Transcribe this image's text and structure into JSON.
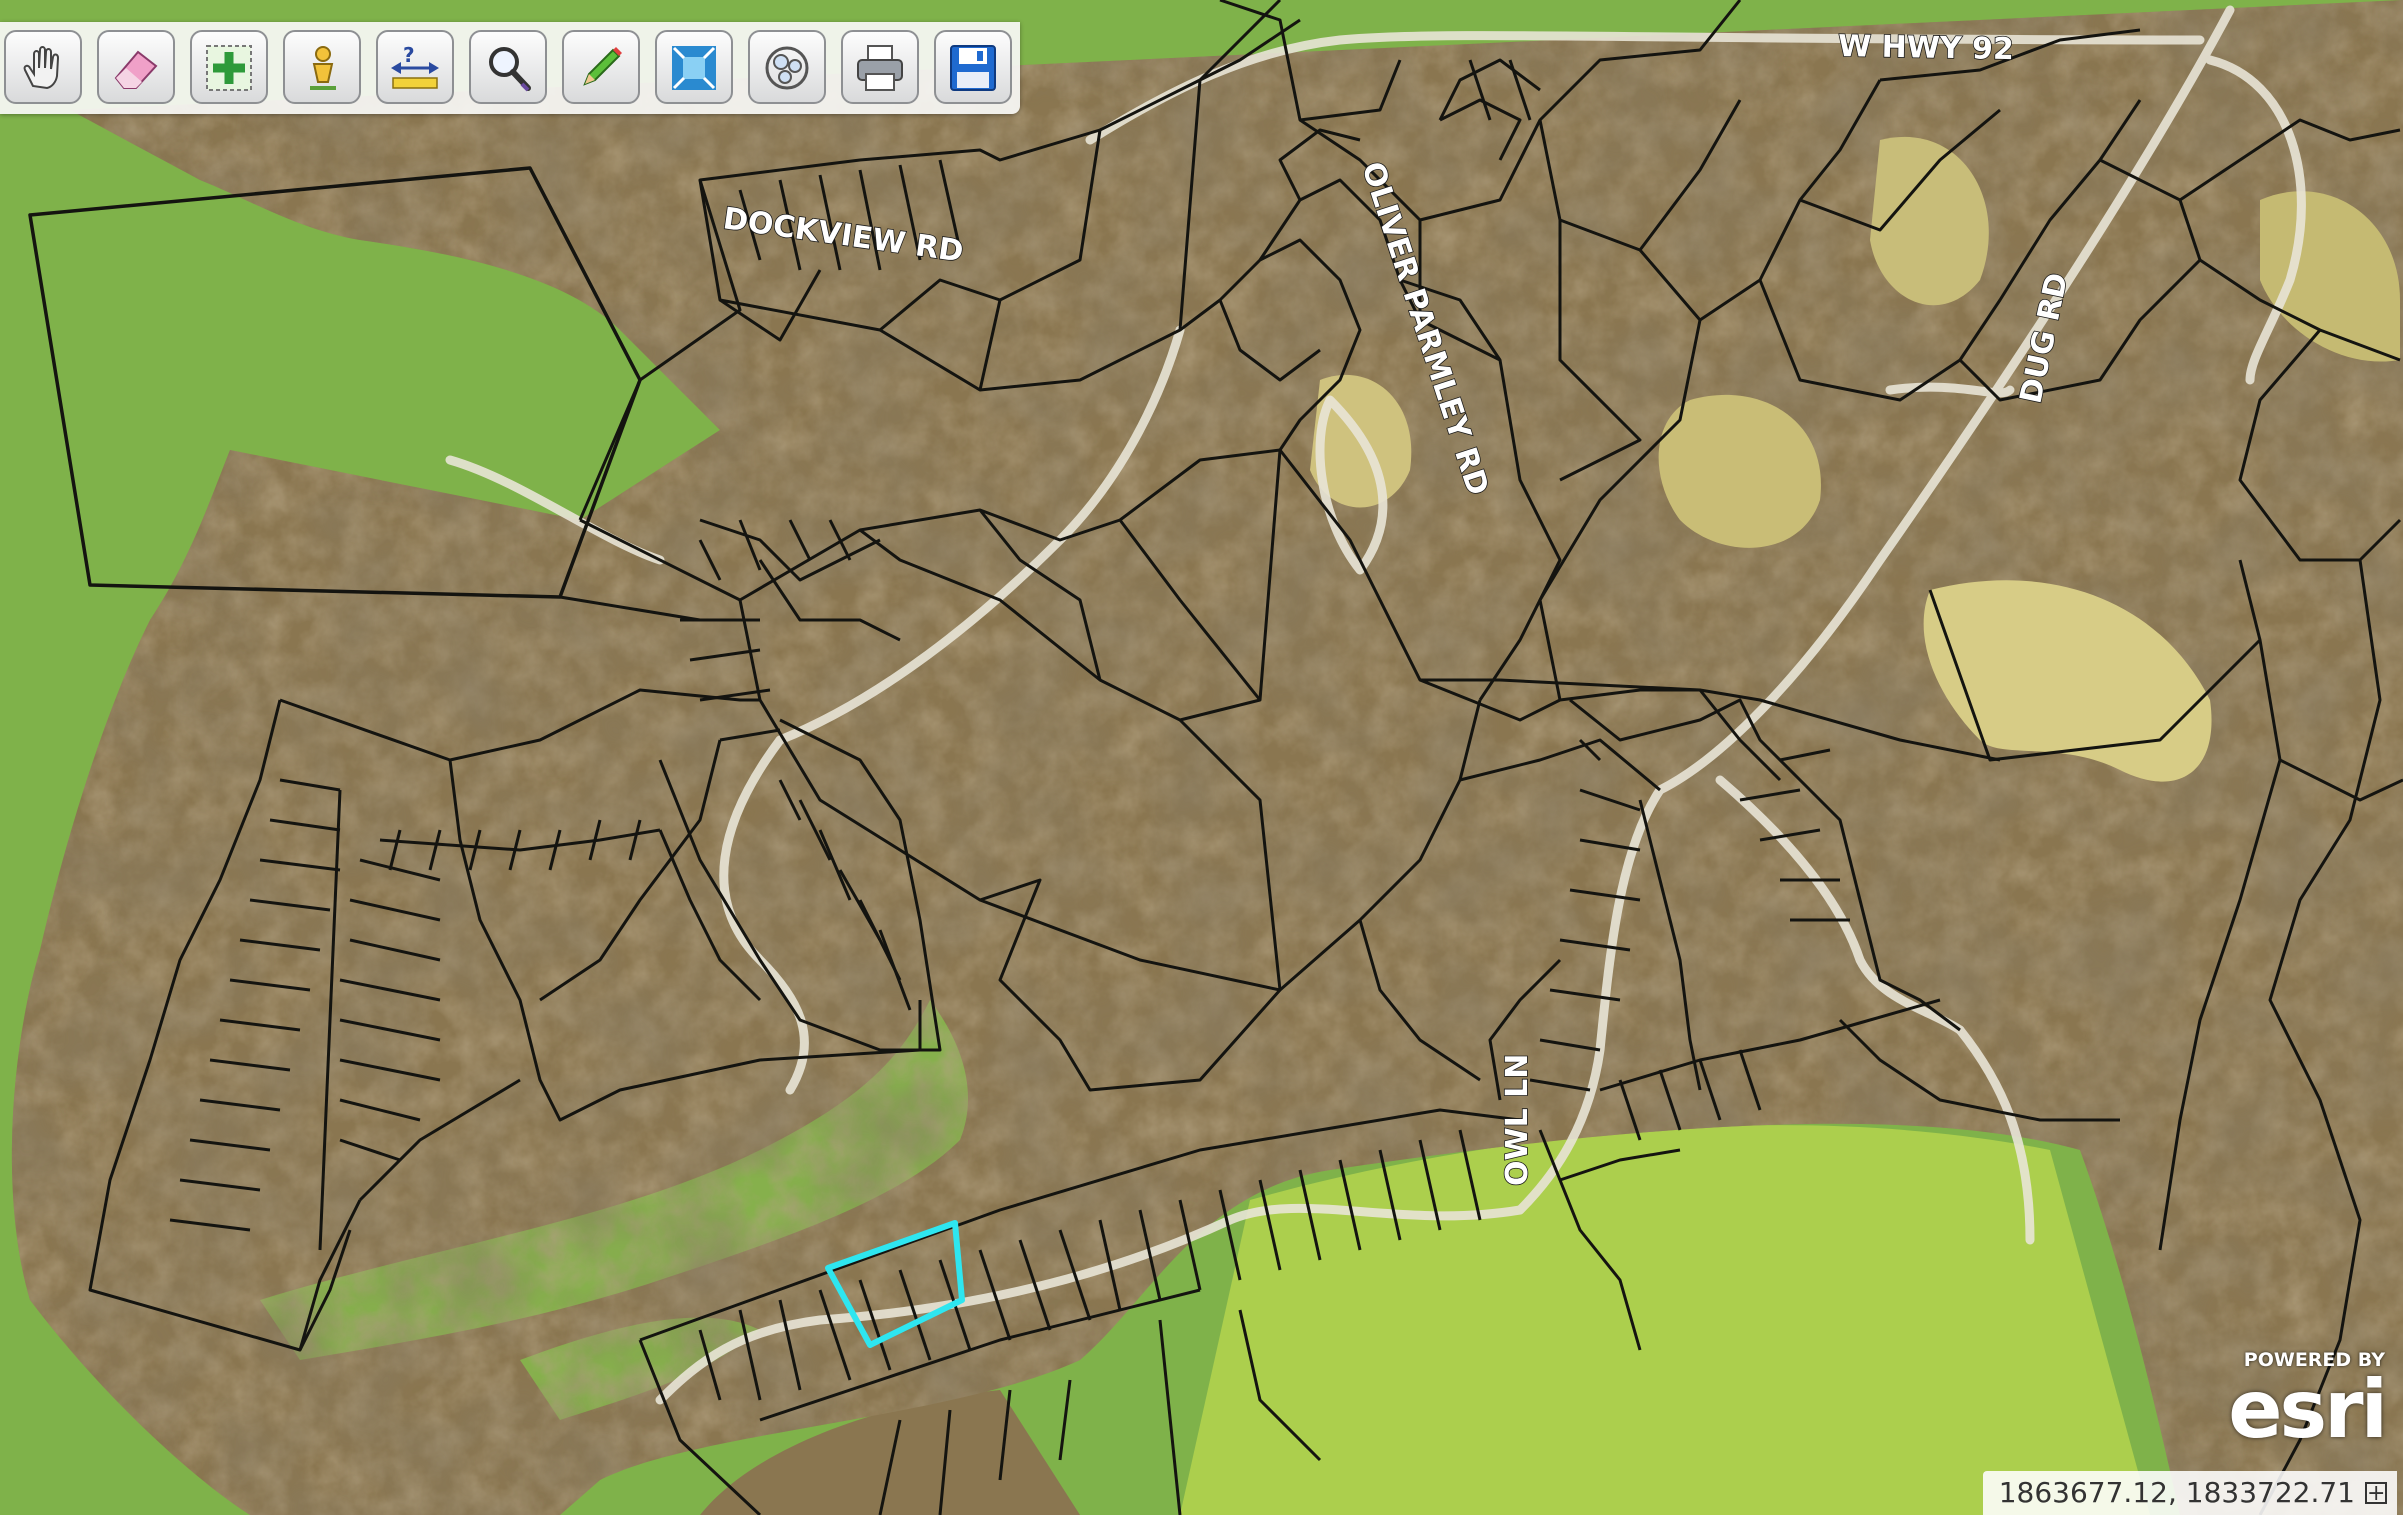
{
  "map": {
    "roads": {
      "w_hwy_92": "W HWY 92",
      "dockview_rd": "DOCKVIEW RD",
      "oliver_parmley_rd": "OLIVER PARMLEY RD",
      "dug_rd": "DUG RD",
      "owl_ln": "OWL LN"
    },
    "parcel_line_color": "#141410",
    "selected_parcel_color": "#2ee6f0",
    "water_color": "#7fb24a",
    "land_color": "#8e7a52"
  },
  "toolbar": {
    "tools": [
      {
        "name": "pan",
        "icon": "hand-icon"
      },
      {
        "name": "clear",
        "icon": "eraser-icon"
      },
      {
        "name": "zoom-full",
        "icon": "full-extent-icon"
      },
      {
        "name": "identify",
        "icon": "person-pin-icon"
      },
      {
        "name": "measure",
        "icon": "measure-icon"
      },
      {
        "name": "search",
        "icon": "magnifier-icon"
      },
      {
        "name": "draw",
        "icon": "pencil-icon"
      },
      {
        "name": "zoom-extent",
        "icon": "zoom-extent-icon"
      },
      {
        "name": "buffer",
        "icon": "buffer-icon"
      },
      {
        "name": "print",
        "icon": "printer-icon"
      },
      {
        "name": "save",
        "icon": "floppy-disk-icon"
      }
    ]
  },
  "status": {
    "coordinates": "1863677.12, 1833722.71",
    "coord_toggle": "+"
  },
  "attribution": {
    "powered_by": "POWERED BY",
    "brand": "esri"
  }
}
